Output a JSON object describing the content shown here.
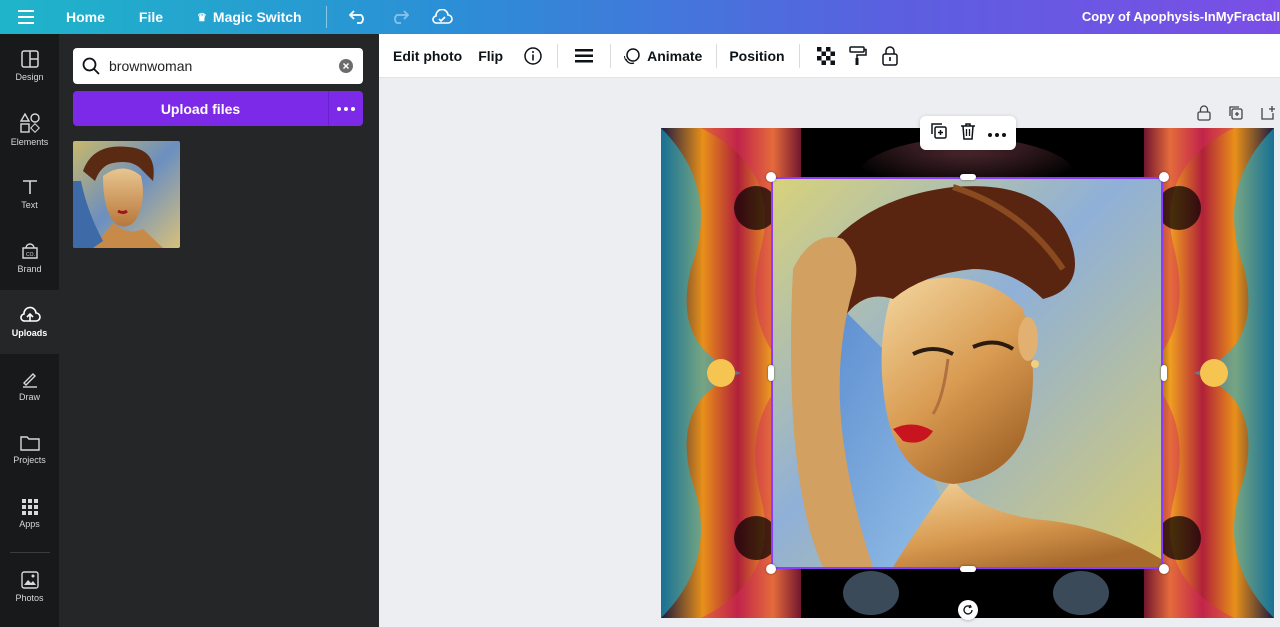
{
  "topbar": {
    "home": "Home",
    "file": "File",
    "magic_switch": "Magic Switch",
    "doc_title": "Copy of Apophysis-InMyFractalI"
  },
  "rail": [
    {
      "label": "Design",
      "icon": "layout-icon"
    },
    {
      "label": "Elements",
      "icon": "shapes-icon"
    },
    {
      "label": "Text",
      "icon": "text-icon"
    },
    {
      "label": "Brand",
      "icon": "brand-icon"
    },
    {
      "label": "Uploads",
      "icon": "cloud-upload-icon"
    },
    {
      "label": "Draw",
      "icon": "pen-icon"
    },
    {
      "label": "Projects",
      "icon": "folder-icon"
    },
    {
      "label": "Apps",
      "icon": "grid-icon"
    },
    {
      "label": "Photos",
      "icon": "image-icon"
    }
  ],
  "panel": {
    "search_value": "brownwoman",
    "upload_label": "Upload files"
  },
  "toolbar": {
    "edit_photo": "Edit photo",
    "flip": "Flip",
    "animate": "Animate",
    "position": "Position"
  },
  "colors": {
    "accent": "#7d2ae8",
    "selection": "#8b3dff",
    "rail_bg": "#18191b",
    "panel_bg": "#252627"
  }
}
